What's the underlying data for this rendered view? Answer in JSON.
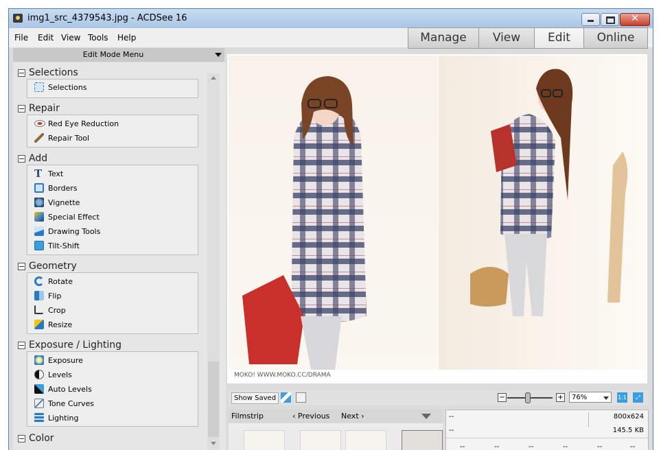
{
  "window": {
    "title": "img1_src_4379543.jpg - ACDSee 16"
  },
  "menu": [
    "File",
    "Edit",
    "View",
    "Tools",
    "Help"
  ],
  "mode_tabs": [
    {
      "label": "Manage",
      "active": false
    },
    {
      "label": "View",
      "active": false
    },
    {
      "label": "Edit",
      "active": true
    },
    {
      "label": "Online",
      "active": false
    }
  ],
  "edit_menu": {
    "header": "Edit Mode Menu",
    "groups": [
      {
        "title": "Selections",
        "tools": [
          {
            "label": "Selections",
            "icon": "selection-icon"
          }
        ]
      },
      {
        "title": "Repair",
        "tools": [
          {
            "label": "Red Eye Reduction",
            "icon": "red-eye-icon"
          },
          {
            "label": "Repair Tool",
            "icon": "repair-tool-icon"
          }
        ]
      },
      {
        "title": "Add",
        "tools": [
          {
            "label": "Text",
            "icon": "text-icon"
          },
          {
            "label": "Borders",
            "icon": "borders-icon"
          },
          {
            "label": "Vignette",
            "icon": "vignette-icon"
          },
          {
            "label": "Special Effect",
            "icon": "special-effect-icon"
          },
          {
            "label": "Drawing Tools",
            "icon": "drawing-tools-icon"
          },
          {
            "label": "Tilt-Shift",
            "icon": "tilt-shift-icon"
          }
        ]
      },
      {
        "title": "Geometry",
        "tools": [
          {
            "label": "Rotate",
            "icon": "rotate-icon"
          },
          {
            "label": "Flip",
            "icon": "flip-icon"
          },
          {
            "label": "Crop",
            "icon": "crop-icon"
          },
          {
            "label": "Resize",
            "icon": "resize-icon"
          }
        ]
      },
      {
        "title": "Exposure / Lighting",
        "tools": [
          {
            "label": "Exposure",
            "icon": "exposure-icon"
          },
          {
            "label": "Levels",
            "icon": "levels-icon"
          },
          {
            "label": "Auto Levels",
            "icon": "auto-levels-icon"
          },
          {
            "label": "Tone Curves",
            "icon": "tone-curves-icon"
          },
          {
            "label": "Lighting",
            "icon": "lighting-icon"
          }
        ]
      },
      {
        "title": "Color",
        "tools": []
      }
    ]
  },
  "viewer": {
    "caption": "MOKO! WWW.MOKO.CC/DRAMA"
  },
  "toolbar": {
    "show_saved": "Show Saved",
    "zoom": "76%",
    "actual_size": "1:1"
  },
  "filmstrip": {
    "label": "Filmstrip",
    "previous": "Previous",
    "next": "Next"
  },
  "info": {
    "left_top": "--",
    "left_bottom": "--",
    "dimensions": "800x624",
    "file_size": "145.5 KB",
    "bottom_cells": [
      "--",
      "--",
      "--",
      "--",
      "--",
      "--"
    ]
  },
  "colors": {
    "titlebar": "#b8d1ec",
    "panel_bg": "#e6e6e6",
    "accent_blue": "#3a9fe0"
  }
}
